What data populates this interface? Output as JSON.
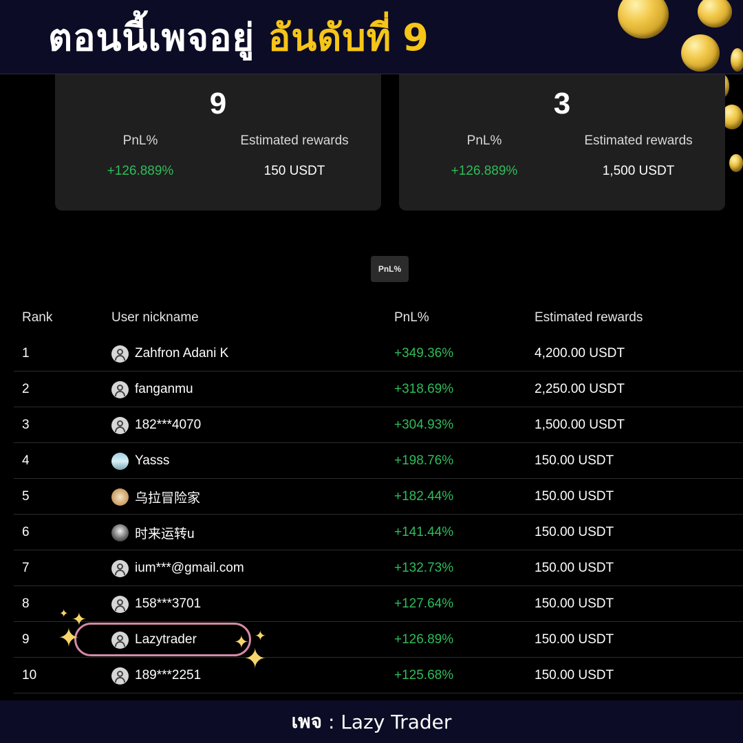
{
  "banner": {
    "title_main": "ตอนนี้เพจอยู่",
    "title_highlight": "อันดับที่",
    "title_number": "9"
  },
  "cards": [
    {
      "rank": "9",
      "pnl_label": "PnL%",
      "pnl_value": "+126.889%",
      "reward_label": "Estimated rewards",
      "reward_value": "150 USDT"
    },
    {
      "rank": "3",
      "pnl_label": "PnL%",
      "pnl_value": "+126.889%",
      "reward_label": "Estimated rewards",
      "reward_value": "1,500 USDT"
    }
  ],
  "sort_pill": "PnL%",
  "table": {
    "headers": {
      "rank": "Rank",
      "nickname": "User nickname",
      "pnl": "PnL%",
      "rewards": "Estimated rewards"
    },
    "rows": [
      {
        "rank": "1",
        "nickname": "Zahfron Adani K",
        "avatar": "default-user-icon",
        "pnl": "+349.36%",
        "rewards": "4,200.00 USDT"
      },
      {
        "rank": "2",
        "nickname": "fanganmu",
        "avatar": "default-user-icon",
        "pnl": "+318.69%",
        "rewards": "2,250.00 USDT"
      },
      {
        "rank": "3",
        "nickname": "182***4070",
        "avatar": "default-user-icon",
        "pnl": "+304.93%",
        "rewards": "1,500.00 USDT"
      },
      {
        "rank": "4",
        "nickname": "Yasss",
        "avatar": "sea-photo-avatar",
        "pnl": "+198.76%",
        "rewards": "150.00 USDT"
      },
      {
        "rank": "5",
        "nickname": "乌拉冒险家",
        "avatar": "cartoon-avatar",
        "pnl": "+182.44%",
        "rewards": "150.00 USDT"
      },
      {
        "rank": "6",
        "nickname": "时来运转u",
        "avatar": "photo-avatar",
        "pnl": "+141.44%",
        "rewards": "150.00 USDT"
      },
      {
        "rank": "7",
        "nickname": "ium***@gmail.com",
        "avatar": "default-user-icon",
        "pnl": "+132.73%",
        "rewards": "150.00 USDT"
      },
      {
        "rank": "8",
        "nickname": "158***3701",
        "avatar": "default-user-icon",
        "pnl": "+127.64%",
        "rewards": "150.00 USDT"
      },
      {
        "rank": "9",
        "nickname": "Lazytrader",
        "avatar": "default-user-icon",
        "pnl": "+126.89%",
        "rewards": "150.00 USDT"
      },
      {
        "rank": "10",
        "nickname": "189***2251",
        "avatar": "default-user-icon",
        "pnl": "+125.68%",
        "rewards": "150.00 USDT"
      }
    ]
  },
  "footer": {
    "label": "เพจ",
    "separator": " : ",
    "name": "Lazy Trader"
  },
  "colors": {
    "banner_bg": "#0c0c26",
    "highlight_yellow": "#f5c518",
    "positive_green": "#2fbd5a",
    "card_bg": "#1f1f1f",
    "oval_pink": "#d58aa8"
  }
}
